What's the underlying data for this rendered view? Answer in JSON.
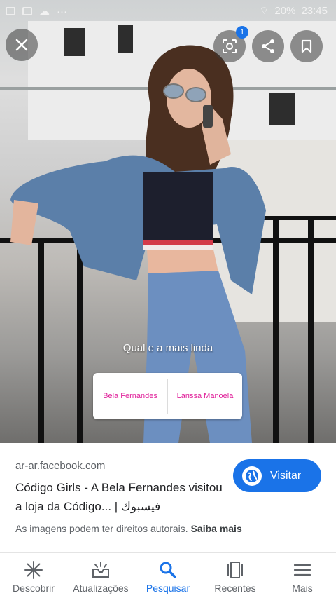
{
  "status_bar": {
    "battery": "20%",
    "time": "23:45"
  },
  "viewer": {
    "notification_count": "1"
  },
  "image": {
    "caption": "Qual e a mais linda"
  },
  "poll": {
    "option_a": "Bela Fernandes",
    "option_b": "Larissa Manoela"
  },
  "result": {
    "domain": "ar-ar.facebook.com",
    "title": "Código Girls - A Bela Fernandes visitou a loja da Código... | فيسبوك",
    "visit_label": "Visitar",
    "copyright_text": "As imagens podem ter direitos autorais.",
    "learn_more": "Saiba mais"
  },
  "nav": {
    "items": [
      {
        "label": "Descobrir",
        "icon": "asterisk-icon"
      },
      {
        "label": "Atualizações",
        "icon": "inbox-icon"
      },
      {
        "label": "Pesquisar",
        "icon": "search-icon",
        "active": true
      },
      {
        "label": "Recentes",
        "icon": "tabs-icon"
      },
      {
        "label": "Mais",
        "icon": "menu-icon"
      }
    ]
  },
  "colors": {
    "accent": "#1a73e8",
    "poll_text": "#e0209a"
  }
}
